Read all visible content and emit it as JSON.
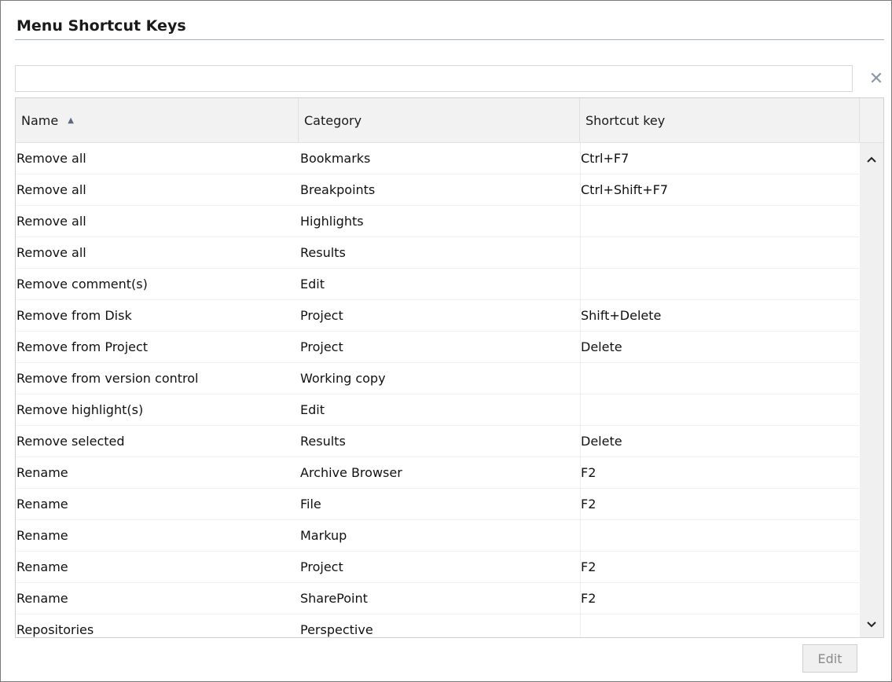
{
  "window": {
    "title": "Menu Shortcut Keys"
  },
  "search": {
    "value": "",
    "placeholder": ""
  },
  "icons": {
    "clear": "close-icon",
    "sort": "sort-ascending-icon",
    "scroll_up": "chevron-up-icon",
    "scroll_down": "chevron-down-icon"
  },
  "table": {
    "columns": [
      {
        "label": "Name",
        "sorted": "ascending"
      },
      {
        "label": "Category"
      },
      {
        "label": "Shortcut key"
      }
    ],
    "rows": [
      {
        "name": "Remove all",
        "category": "Bookmarks",
        "shortcut": "Ctrl+F7"
      },
      {
        "name": "Remove all",
        "category": "Breakpoints",
        "shortcut": "Ctrl+Shift+F7"
      },
      {
        "name": "Remove all",
        "category": "Highlights",
        "shortcut": ""
      },
      {
        "name": "Remove all",
        "category": "Results",
        "shortcut": ""
      },
      {
        "name": "Remove comment(s)",
        "category": "Edit",
        "shortcut": ""
      },
      {
        "name": "Remove from Disk",
        "category": "Project",
        "shortcut": "Shift+Delete"
      },
      {
        "name": "Remove from Project",
        "category": "Project",
        "shortcut": "Delete"
      },
      {
        "name": "Remove from version control",
        "category": "Working copy",
        "shortcut": ""
      },
      {
        "name": "Remove highlight(s)",
        "category": "Edit",
        "shortcut": ""
      },
      {
        "name": "Remove selected",
        "category": "Results",
        "shortcut": "Delete"
      },
      {
        "name": "Rename",
        "category": "Archive Browser",
        "shortcut": "F2"
      },
      {
        "name": "Rename",
        "category": "File",
        "shortcut": "F2"
      },
      {
        "name": "Rename",
        "category": "Markup",
        "shortcut": ""
      },
      {
        "name": "Rename",
        "category": "Project",
        "shortcut": "F2"
      },
      {
        "name": "Rename",
        "category": "SharePoint",
        "shortcut": "F2"
      },
      {
        "name": "Repositories",
        "category": "Perspective",
        "shortcut": ""
      }
    ]
  },
  "footer": {
    "edit_label": "Edit",
    "edit_enabled": false
  },
  "colors": {
    "title_rule": "#9fb3c8",
    "header_bg": "#f2f2f2",
    "clear_icon": "#8a98a8",
    "disabled_text": "#8a8a8a"
  }
}
